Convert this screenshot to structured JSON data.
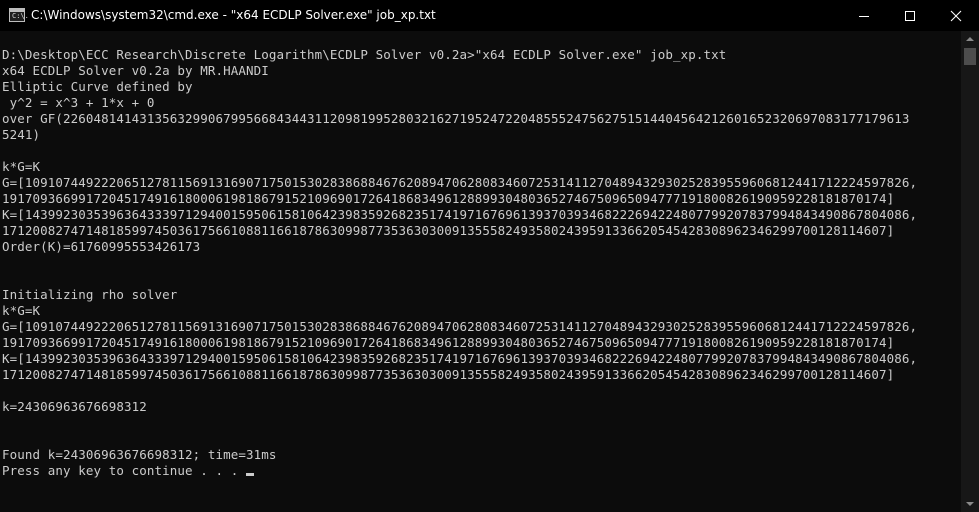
{
  "window": {
    "title": "C:\\Windows\\system32\\cmd.exe - \"x64 ECDLP Solver.exe\"  job_xp.txt",
    "icon": "cmd-icon",
    "icon_text": "C:\\."
  },
  "controls": {
    "minimize_icon": "minimize-icon",
    "maximize_icon": "maximize-icon",
    "close_icon": "close-icon"
  },
  "console": {
    "lines": [
      "D:\\Desktop\\ECC Research\\Discrete Logarithm\\ECDLP Solver v0.2a>\"x64 ECDLP Solver.exe\" job_xp.txt",
      "x64 ECDLP Solver v0.2a by MR.HAANDI",
      "Elliptic Curve defined by",
      " y^2 = x^3 + 1*x + 0",
      "over GF(226048141431356329906799566843443112098199528032162719524722048555247562751514404564212601652320697083177179613",
      "5241)",
      "",
      "k*G=K",
      "G=[10910744922206512781156913169071750153028386884676208947062808346072531411270489432930252839559606812441712224597826,",
      "19170936699172045174916180006198186791521096901726418683496128899304803652746750965094777191800826190959228181870174]",
      "K=[14399230353963643339712940015950615810642398359268235174197167696139370393468222694224807799207837994843490867804086,",
      "17120082747148185997450361756610881166187863099877353630300913555824935802439591336620545428308962346299700128114607]",
      "Order(K)=61760995553426173",
      "",
      "",
      "Initializing rho solver",
      "k*G=K",
      "G=[10910744922206512781156913169071750153028386884676208947062808346072531411270489432930252839559606812441712224597826,",
      "19170936699172045174916180006198186791521096901726418683496128899304803652746750965094777191800826190959228181870174]",
      "K=[14399230353963643339712940015950615810642398359268235174197167696139370393468222694224807799207837994843490867804086,",
      "17120082747148185997450361756610881166187863099877353630300913555824935802439591336620545428308962346299700128114607]",
      "",
      "k=24306963676698312",
      "",
      "",
      "Found k=24306963676698312; time=31ms",
      "Press any key to continue . . . "
    ]
  }
}
